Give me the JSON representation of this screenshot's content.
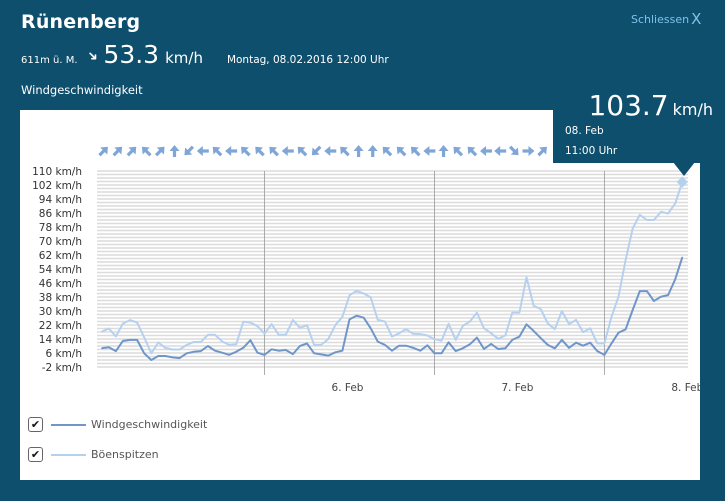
{
  "header": {
    "title": "Rünenberg",
    "close_label": "Schliessen",
    "close_icon": "X",
    "altitude": "611m ü. M.",
    "direction_icon": "arrow-northeast",
    "current_speed": "53.3",
    "speed_unit": "km/h",
    "datetime": "Montag, 08.02.2016 12:00 Uhr",
    "section_title": "Windgeschwindigkeit"
  },
  "tooltip": {
    "value": "103.7",
    "unit": "km/h",
    "date": "08. Feb",
    "time": "11:00 Uhr"
  },
  "legend": [
    {
      "label": "Windgeschwindigkeit",
      "checked": true,
      "color": "#7096c9"
    },
    {
      "label": "Böenspitzen",
      "checked": true,
      "color": "#b6d1ef"
    }
  ],
  "colors": {
    "background": "#0f4f6e",
    "accent": "#7cc3ea",
    "arrows": "#7fa6d6",
    "grid": "#dcdcdc"
  },
  "chart_data": {
    "type": "line",
    "x_start": "05.02.2016 01:00",
    "x_step": "1 hour",
    "x_end": "08.02.2016 11:00",
    "x_tick_labels": [
      "6. Feb",
      "7. Feb",
      "8. Feb"
    ],
    "y_tick_labels": [
      "110 km/h",
      "102 km/h",
      "94 km/h",
      "86 km/h",
      "78 km/h",
      "70 km/h",
      "62 km/h",
      "54 km/h",
      "46 km/h",
      "38 km/h",
      "30 km/h",
      "22 km/h",
      "14 km/h",
      "6 km/h",
      "-2 km/h"
    ],
    "ylim": [
      -2,
      110
    ],
    "grid": true,
    "legend_position": "bottom-left",
    "series": [
      {
        "name": "Windgeschwindigkeit",
        "color": "#7096c9",
        "values": [
          8.7,
          9.3,
          7.1,
          12.9,
          13.5,
          13.5,
          5.8,
          2,
          4.3,
          4.3,
          3.5,
          3.1,
          5.8,
          6.7,
          7.1,
          10,
          7.3,
          6.2,
          5,
          6.7,
          9,
          13.3,
          6.2,
          4.9,
          8.1,
          7.3,
          7.7,
          5.4,
          10,
          11.5,
          5.8,
          5.2,
          4.5,
          6.4,
          7.3,
          25.2,
          27.3,
          26.2,
          20.1,
          12.5,
          10.6,
          7.3,
          10.2,
          10.2,
          9,
          7.3,
          10.4,
          5.8,
          5.8,
          12.1,
          7.1,
          8.7,
          11,
          14.8,
          8.3,
          11.2,
          8.3,
          8.7,
          13.5,
          15.4,
          22.4,
          18.6,
          14.5,
          10.6,
          8.7,
          13.5,
          9,
          11.9,
          10.2,
          11.9,
          7.1,
          4.9,
          11.5,
          17.6,
          19.5,
          30.6,
          41.4,
          41.4,
          35.7,
          38.2,
          39.1,
          48.1,
          60.7
        ]
      },
      {
        "name": "Böenspitzen",
        "color": "#b6d1ef",
        "values": [
          18.2,
          20,
          15.5,
          22.8,
          24.8,
          23.4,
          15,
          5.8,
          12,
          8.9,
          8,
          8,
          10.6,
          12.3,
          12.3,
          16.4,
          16.4,
          12.6,
          10.6,
          11,
          23.8,
          23.4,
          21.3,
          17.1,
          22.5,
          16.4,
          16.4,
          24.8,
          20.4,
          21.9,
          10.6,
          10.6,
          14,
          21.9,
          26.7,
          39,
          41.5,
          40,
          37.8,
          24.9,
          24,
          15.4,
          17.3,
          19.6,
          17,
          16.8,
          16,
          13.9,
          13.1,
          22.7,
          13.5,
          21.5,
          24,
          29.1,
          20.1,
          17.3,
          14.1,
          16,
          29.1,
          29.1,
          49.3,
          33,
          31.2,
          23,
          19.6,
          30,
          22.5,
          24.9,
          17.9,
          20.1,
          11.5,
          11.5,
          26.7,
          38.2,
          59.1,
          77.2,
          84.9,
          82,
          82,
          86.7,
          85.7,
          91.5,
          103.7
        ]
      }
    ],
    "wind_direction_arrows_step": "2 hours",
    "wind_direction_arrows_deg": [
      45,
      45,
      45,
      -45,
      45,
      0,
      -135,
      -90,
      -45,
      -90,
      -45,
      -45,
      -45,
      -90,
      -45,
      -135,
      -90,
      -45,
      0,
      0,
      -45,
      -45,
      -45,
      -90,
      0,
      -45,
      -45,
      -90,
      -90,
      135,
      90,
      45
    ]
  }
}
